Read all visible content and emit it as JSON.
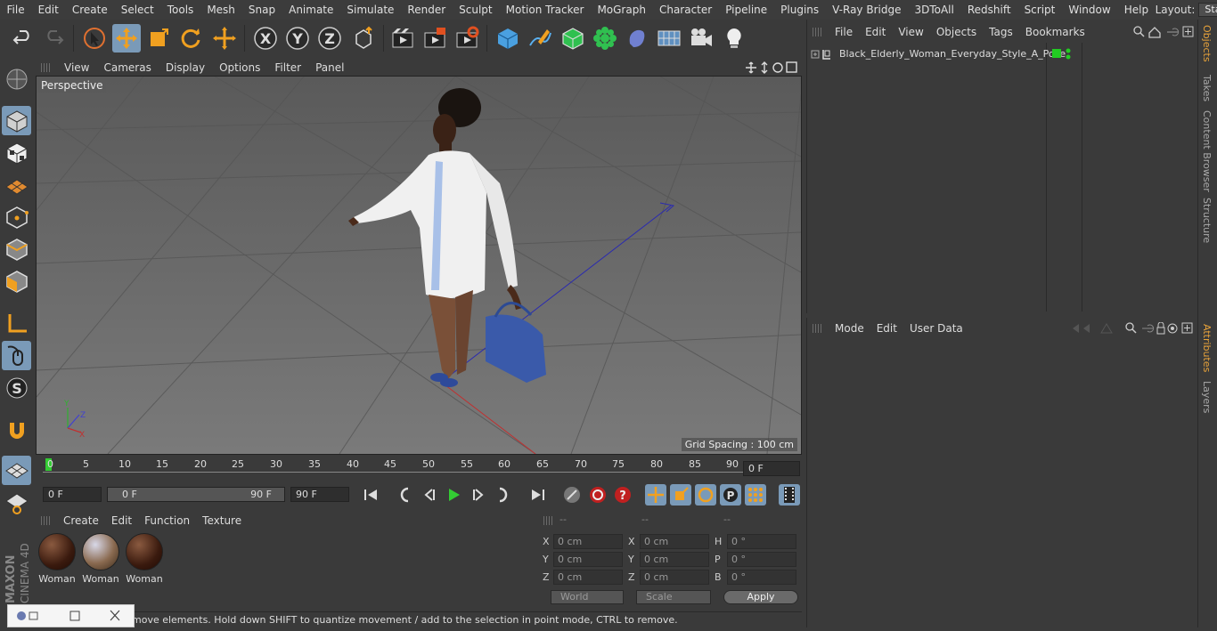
{
  "menubar": {
    "items": [
      "File",
      "Edit",
      "Create",
      "Select",
      "Tools",
      "Mesh",
      "Snap",
      "Animate",
      "Simulate",
      "Render",
      "Sculpt",
      "Motion Tracker",
      "MoGraph",
      "Character",
      "Pipeline",
      "Plugins",
      "V-Ray Bridge",
      "3DToAll",
      "Redshift",
      "Script",
      "Window",
      "Help"
    ],
    "layout_label": "Layout:",
    "layout_value": "Startup"
  },
  "toolbar": {
    "icons": [
      "undo-icon",
      "redo-icon",
      "live-selection-icon",
      "move-icon",
      "scale-icon",
      "rotate-icon",
      "transform-icon",
      "x-axis-icon",
      "y-axis-icon",
      "z-axis-icon",
      "coordinate-system-icon",
      "render-view-icon",
      "render-picture-viewer-icon",
      "edit-render-settings-icon",
      "cube-icon",
      "pen-icon",
      "subdivision-icon",
      "cloner-icon",
      "deformer-icon",
      "floor-icon",
      "camera-icon",
      "light-icon"
    ],
    "axis_x": "X",
    "axis_y": "Y",
    "axis_z": "Z"
  },
  "viewport": {
    "menu": [
      "View",
      "Cameras",
      "Display",
      "Options",
      "Filter",
      "Panel"
    ],
    "label": "Perspective",
    "grid_spacing": "Grid Spacing : 100 cm"
  },
  "timeline": {
    "ticks": [
      "0",
      "5",
      "10",
      "15",
      "20",
      "25",
      "30",
      "35",
      "40",
      "45",
      "50",
      "55",
      "60",
      "65",
      "70",
      "75",
      "80",
      "85",
      "90"
    ],
    "current_frame": "0 F",
    "start_field": "0 F",
    "range_start": "0 F",
    "range_end": "90 F",
    "end_field": "90 F"
  },
  "materials": {
    "menu": [
      "Create",
      "Edit",
      "Function",
      "Texture"
    ],
    "items": [
      "Woman",
      "Woman",
      "Woman"
    ]
  },
  "coordinates": {
    "headers": [
      "--",
      "--",
      "--"
    ],
    "rows": [
      {
        "a": "X",
        "av": "0 cm",
        "b": "X",
        "bv": "0 cm",
        "c": "H",
        "cv": "0 °"
      },
      {
        "a": "Y",
        "av": "0 cm",
        "b": "Y",
        "bv": "0 cm",
        "c": "P",
        "cv": "0 °"
      },
      {
        "a": "Z",
        "av": "0 cm",
        "b": "Z",
        "bv": "0 cm",
        "c": "B",
        "cv": "0 °"
      }
    ],
    "world": "World",
    "scale": "Scale",
    "apply": "Apply"
  },
  "status": {
    "text": "move elements. Hold down SHIFT to quantize movement / add to the selection in point mode, CTRL to remove."
  },
  "objects": {
    "menu": [
      "File",
      "Edit",
      "View",
      "Objects",
      "Tags",
      "Bookmarks"
    ],
    "items": [
      {
        "name": "Black_Elderly_Woman_Everyday_Style_A_Pose",
        "layer_color": "#22cc22"
      }
    ]
  },
  "attributes": {
    "menu": [
      "Mode",
      "Edit",
      "User Data"
    ]
  },
  "sidetabs": [
    "Objects",
    "Takes",
    "Content Browser",
    "Structure",
    "Attributes",
    "Layers"
  ],
  "logo": {
    "brand": "MAXON",
    "product": "CINEMA 4D"
  },
  "colors": {
    "accent_select": "#7a9ab8",
    "tab_active": "#e8a33a",
    "play_green": "#33cc33"
  }
}
